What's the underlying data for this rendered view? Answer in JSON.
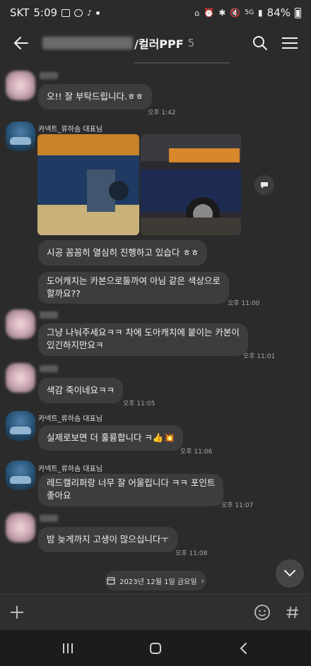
{
  "status_bar": {
    "carrier": "SKT",
    "time": "5:09",
    "battery": "84%"
  },
  "header": {
    "title_suffix": "/컬러PPF",
    "member_count": "5"
  },
  "messages": [
    {
      "sender": "",
      "text": "오!! 잘 부탁드립니다.ㅎㅎ",
      "time": "오후 1:42"
    },
    {
      "sender": "카넥트_류하솜 대표님",
      "type": "photos"
    },
    {
      "sender": "",
      "text": "시공 꼼꼼히 열심히 진행하고 있습다 ㅎㅎ"
    },
    {
      "sender": "",
      "text_line1": "도어캐치는 카본으로둘까여 아님 같은 색상으로",
      "text_line2": "할까요??",
      "time": "오후 11:00"
    },
    {
      "sender": "",
      "text_line1": "그냥 나눠주세요ㅋㅋ 차에 도아캐치에 붙이는 카본이",
      "text_line2": "있긴하지만요ㅋ",
      "time": "오후 11:01"
    },
    {
      "sender": "",
      "text": "색감 죽이네요ㅋㅋ",
      "time": "오후 11:05"
    },
    {
      "sender": "카넥트_류하솜 대표님",
      "text": "실제로보면 더 훌륭합니다 ㅋ👍💥",
      "time": "오후 11:06"
    },
    {
      "sender": "카넥트_류하솜 대표님",
      "text_line1": "레드캘리퍼랑 너무 잘 어울립니다 ㅋㅋ 포인트",
      "text_line2": "좋아요",
      "time": "오후 11:07"
    },
    {
      "sender": "",
      "text": "밤 늦게까지 고생이 많으십니다ㅜ",
      "time": "오후 11:08"
    }
  ],
  "date_chip": "2023년 12월 1일 금요일",
  "colors": {
    "background": "#2b2b2b",
    "bubble": "#3d3d3d",
    "nav": "#1c1c1c"
  }
}
